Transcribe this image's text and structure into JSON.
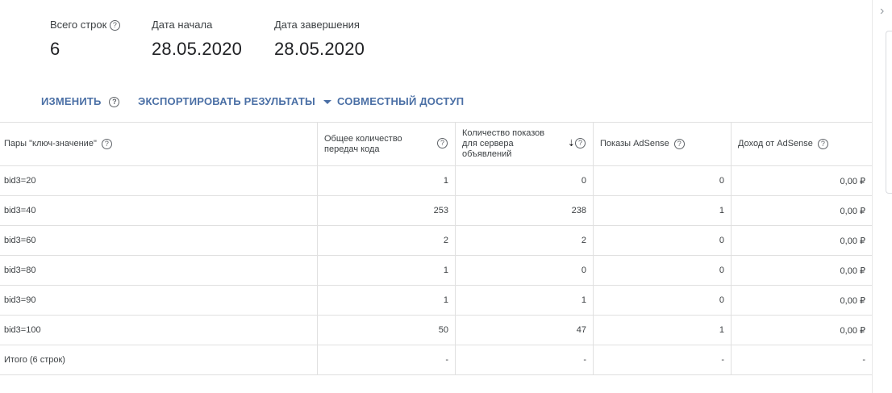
{
  "summary": {
    "total_rows": {
      "label": "Всего строк",
      "value": "6"
    },
    "start_date": {
      "label": "Дата начала",
      "value": "28.05.2020"
    },
    "end_date": {
      "label": "Дата завершения",
      "value": "28.05.2020"
    }
  },
  "toolbar": {
    "edit_label": "ИЗМЕНИТЬ",
    "export_label": "ЭКСПОРТИРОВАТЬ РЕЗУЛЬТАТЫ",
    "share_label": "СОВМЕСТНЫЙ ДОСТУП"
  },
  "table": {
    "headers": [
      "Пары \"ключ-значение\"",
      "Общее количество передач кода",
      "Количество показов для сервера объявлений",
      "Показы AdSense",
      "Доход от AdSense"
    ],
    "rows": [
      [
        "bid3=20",
        "1",
        "0",
        "0",
        "0,00 ₽"
      ],
      [
        "bid3=40",
        "253",
        "238",
        "1",
        "0,00 ₽"
      ],
      [
        "bid3=60",
        "2",
        "2",
        "0",
        "0,00 ₽"
      ],
      [
        "bid3=80",
        "1",
        "0",
        "0",
        "0,00 ₽"
      ],
      [
        "bid3=90",
        "1",
        "1",
        "0",
        "0,00 ₽"
      ],
      [
        "bid3=100",
        "50",
        "47",
        "1",
        "0,00 ₽"
      ],
      [
        "Итого (6 строк)",
        "-",
        "-",
        "-",
        "-"
      ]
    ]
  },
  "icons": {
    "help": "help-circle-icon",
    "sort": "sort-down-icon",
    "caret": "caret-down-icon",
    "chevron": "chevron-right-icon"
  }
}
